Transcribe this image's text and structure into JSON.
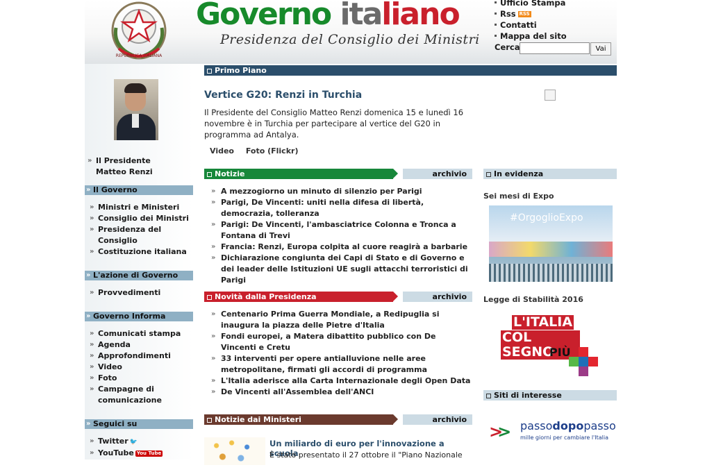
{
  "header": {
    "brand_g": "Governo",
    "brand_sp": " ",
    "brand_w": "ita",
    "brand_r": "liano",
    "subtitle": "Presidenza del Consiglio dei Ministri",
    "emblem_text": "REPUBBLICA ITALIANA",
    "links": [
      "Ufficio Stampa",
      "Rss",
      "Contatti",
      "Mappa del sito"
    ],
    "rss_badge": "RSS",
    "search_label": "Cerca:",
    "search_value": "",
    "search_button": "Vai"
  },
  "sidebar": {
    "president_line1": "Il Presidente",
    "president_line2": "Matteo Renzi",
    "sections": [
      {
        "title": "Il Governo",
        "items": [
          "Ministri e Ministeri",
          "Consiglio dei Ministri",
          "Presidenza del",
          "Consiglio",
          "Costituzione italiana"
        ]
      },
      {
        "title": "L'azione di Governo",
        "items": [
          "Provvedimenti"
        ]
      },
      {
        "title": "Governo Informa",
        "items": [
          "Comunicati stampa",
          "Agenda",
          "Approfondimenti",
          "Video",
          "Foto",
          "Campagne di",
          "comunicazione"
        ]
      },
      {
        "title": "Seguici su",
        "items": [
          "Twitter",
          "YouTube"
        ]
      }
    ],
    "youtube_badge": "You Tube"
  },
  "primo_piano": {
    "bar_title": "Primo Piano",
    "headline": "Vertice G20: Renzi in Turchia",
    "lead": "Il Presidente del Consiglio Matteo Renzi domenica 15 e lunedì 16 novembre è in Turchia per partecipare al vertice del G20 in programma ad Antalya.",
    "links": [
      "Video",
      "Foto (Flickr)"
    ]
  },
  "notizie": {
    "title": "Notizie",
    "archive": "archivio",
    "color": "#17873a",
    "items": [
      "A mezzogiorno un minuto di silenzio per Parigi",
      "Parigi, De Vincenti: uniti nella difesa di libertà, democrazia, tolleranza",
      "Parigi: De Vincenti, l'ambasciatrice Colonna e Tronca a Fontana di Trevi",
      "Francia: Renzi, Europa colpita al cuore reagirà a barbarie",
      "Dichiarazione congiunta dei Capi di Stato e di Governo e dei leader delle Istituzioni UE sugli attacchi terroristici di Parigi"
    ]
  },
  "novita": {
    "title": "Novità dalla Presidenza",
    "archive": "archivio",
    "color": "#c9202c",
    "items": [
      "Centenario Prima Guerra Mondiale, a Redipuglia si inaugura la piazza delle Pietre d'Italia",
      "Fondi europei, a Matera dibattito pubblico con De Vincenti e Cretu",
      "33 interventi per opere antialluvione nelle aree metropolitane, firmati gli accordi di programma",
      "L'Italia aderisce alla Carta Internazionale degli Open Data",
      "De Vincenti all'Assemblea dell'ANCI"
    ]
  },
  "ministeri": {
    "title": "Notizie dai Ministeri",
    "archive": "archivio",
    "color": "#6b3a2e",
    "item_title": "Un miliardo di euro per l'innovazione a scuola",
    "item_text": "È stato presentato il 27 ottobre il \"Piano Nazionale"
  },
  "right": {
    "evidenza_title": "In evidenza",
    "expo_title": "Sei mesi di Expo",
    "expo_tag": "#OrgoglioExpo",
    "stabilita_title": "Legge di Stabilità 2016",
    "stabilita_l1": "L'ITALIA",
    "stabilita_l2": "COL SEGNO",
    "stabilita_l3": "PIÙ",
    "siti_title": "Siti di interesse",
    "pdp_name_a": "passo",
    "pdp_name_b": "dopo",
    "pdp_name_c": "passo",
    "pdp_tagline": "mille giorni per cambiare l'Italia"
  },
  "colors": {
    "primo_bar": "#2b4e6b",
    "side_bar": "#8fb0c4",
    "grey_bar": "#ccdbe4"
  }
}
